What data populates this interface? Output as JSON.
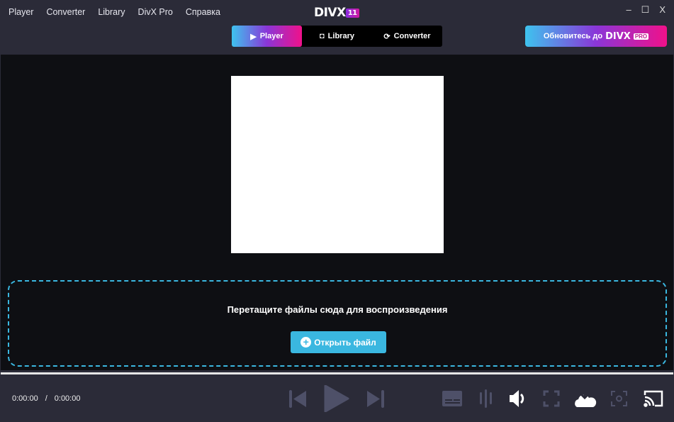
{
  "menu": [
    "Player",
    "Converter",
    "Library",
    "DivX Pro",
    "Справка"
  ],
  "logo": {
    "text": "DIVX",
    "badge": "11"
  },
  "window": {
    "minimize": "–",
    "maximize": "☐",
    "close": "X"
  },
  "tabs": [
    {
      "label": "Player",
      "icon": "play-icon",
      "active": true
    },
    {
      "label": "Library",
      "icon": "library-icon"
    },
    {
      "label": "Converter",
      "icon": "converter-icon"
    }
  ],
  "upgrade": {
    "label": "Обновитесь до",
    "brand": "DIVX",
    "badge": "PRO"
  },
  "drop": {
    "text": "Перетащите файлы сюда для воспроизведения",
    "open_label": "Открыть файл"
  },
  "player": {
    "current": "0:00:00",
    "separator": "/",
    "total": "0:00:00",
    "progress": 0
  },
  "colors": {
    "accent": "#3ab7e0",
    "inactive": "#4e5068"
  }
}
